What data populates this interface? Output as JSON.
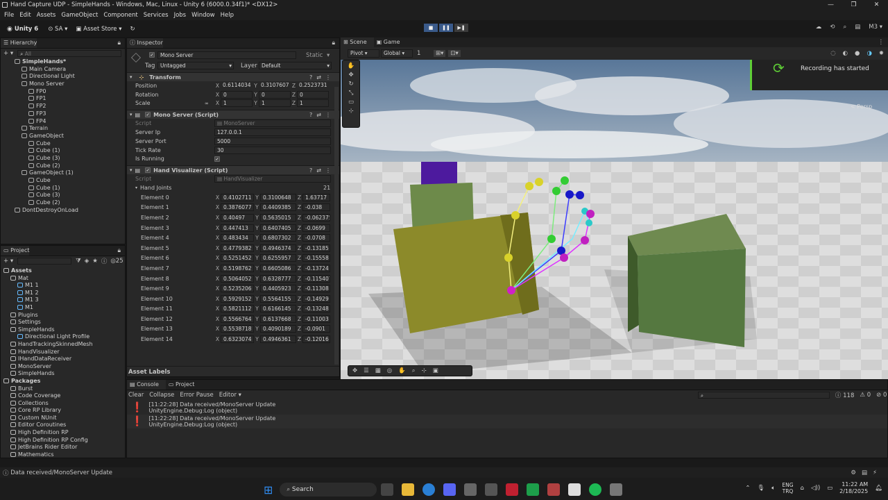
{
  "window": {
    "title": "Hand Capture UDP - SimpleHands - Windows, Mac, Linux - Unity 6 (6000.0.34f1)* <DX12>",
    "controls": [
      "—",
      "❐",
      "✕"
    ]
  },
  "menu": [
    "File",
    "Edit",
    "Assets",
    "GameObject",
    "Component",
    "Services",
    "Jobs",
    "Window",
    "Help"
  ],
  "toolbar": {
    "account": "Unity 6",
    "user": "SA",
    "store": "Asset Store",
    "layout": "M3"
  },
  "hierarchy": {
    "tab": "Hierarchy",
    "search_placeholder": "All",
    "items": [
      {
        "label": "SimpleHands*",
        "indent": 0,
        "bold": true
      },
      {
        "label": "Main Camera",
        "indent": 1
      },
      {
        "label": "Directional Light",
        "indent": 1
      },
      {
        "label": "Mono Server",
        "indent": 1
      },
      {
        "label": "FP0",
        "indent": 2
      },
      {
        "label": "FP1",
        "indent": 2
      },
      {
        "label": "FP2",
        "indent": 2
      },
      {
        "label": "FP3",
        "indent": 2
      },
      {
        "label": "FP4",
        "indent": 2
      },
      {
        "label": "Terrain",
        "indent": 1
      },
      {
        "label": "GameObject",
        "indent": 1
      },
      {
        "label": "Cube",
        "indent": 2
      },
      {
        "label": "Cube (1)",
        "indent": 2
      },
      {
        "label": "Cube (3)",
        "indent": 2
      },
      {
        "label": "Cube (2)",
        "indent": 2
      },
      {
        "label": "GameObject (1)",
        "indent": 1
      },
      {
        "label": "Cube",
        "indent": 2
      },
      {
        "label": "Cube (1)",
        "indent": 2
      },
      {
        "label": "Cube (3)",
        "indent": 2
      },
      {
        "label": "Cube (2)",
        "indent": 2
      },
      {
        "label": "DontDestroyOnLoad",
        "indent": 0
      }
    ]
  },
  "project": {
    "tab": "Project",
    "badge": "25",
    "items": [
      {
        "label": "Assets",
        "indent": 0,
        "bold": true
      },
      {
        "label": "Mat",
        "indent": 1
      },
      {
        "label": "M1 1",
        "indent": 2
      },
      {
        "label": "M1 2",
        "indent": 2
      },
      {
        "label": "M1 3",
        "indent": 2
      },
      {
        "label": "M1",
        "indent": 2
      },
      {
        "label": "Plugins",
        "indent": 1
      },
      {
        "label": "Settings",
        "indent": 1
      },
      {
        "label": "SimpleHands",
        "indent": 1
      },
      {
        "label": "Directional Light Profile",
        "indent": 2
      },
      {
        "label": "HandTrackingSkinnedMesh",
        "indent": 1
      },
      {
        "label": "HandVisualizer",
        "indent": 1
      },
      {
        "label": "IHandDataReceiver",
        "indent": 1
      },
      {
        "label": "MonoServer",
        "indent": 1
      },
      {
        "label": "SimpleHands",
        "indent": 1
      },
      {
        "label": "Packages",
        "indent": 0,
        "bold": true
      },
      {
        "label": "Burst",
        "indent": 1
      },
      {
        "label": "Code Coverage",
        "indent": 1
      },
      {
        "label": "Collections",
        "indent": 1
      },
      {
        "label": "Core RP Library",
        "indent": 1
      },
      {
        "label": "Custom NUnit",
        "indent": 1
      },
      {
        "label": "Editor Coroutines",
        "indent": 1
      },
      {
        "label": "High Definition RP",
        "indent": 1
      },
      {
        "label": "High Definition RP Config",
        "indent": 1
      },
      {
        "label": "JetBrains Rider Editor",
        "indent": 1
      },
      {
        "label": "Mathematics",
        "indent": 1
      }
    ]
  },
  "inspector": {
    "tab": "Inspector",
    "object_name": "Mono Server",
    "static_label": "Static",
    "tag_label": "Tag",
    "tag_value": "Untagged",
    "layer_label": "Layer",
    "layer_value": "Default",
    "transform": {
      "title": "Transform",
      "position_label": "Position",
      "rotation_label": "Rotation",
      "scale_label": "Scale",
      "position": [
        "0.6114034",
        "0.3107607",
        "0.2523731"
      ],
      "rotation": [
        "0",
        "0",
        "0"
      ],
      "scale": [
        "1",
        "1",
        "1"
      ]
    },
    "mono": {
      "title": "Mono Server (Script)",
      "script_label": "Script",
      "script_value": "MonoServer",
      "fields": [
        {
          "label": "Server Ip",
          "value": "127.0.0.1"
        },
        {
          "label": "Server Port",
          "value": "5000"
        },
        {
          "label": "Tick Rate",
          "value": "30"
        },
        {
          "label": "Is Running",
          "value": "✓"
        }
      ]
    },
    "hv": {
      "title": "Hand Visualizer (Script)",
      "script_label": "Script",
      "script_value": "HandVisualizer",
      "joints_label": "Hand Joints",
      "joints_count": "21",
      "elements": [
        {
          "label": "Element 0",
          "x": "0.4102711",
          "y": "0.3100648",
          "z": "1.63717"
        },
        {
          "label": "Element 1",
          "x": "0.3876077",
          "y": "0.4409385",
          "z": "-0.038"
        },
        {
          "label": "Element 2",
          "x": "0.40497",
          "y": "0.5635015",
          "z": "-0.062375"
        },
        {
          "label": "Element 3",
          "x": "0.447413",
          "y": "0.6407405",
          "z": "-0.0699"
        },
        {
          "label": "Element 4",
          "x": "0.483434",
          "y": "0.6807302",
          "z": "-0.0708"
        },
        {
          "label": "Element 5",
          "x": "0.4779382",
          "y": "0.4946374",
          "z": "-0.13185"
        },
        {
          "label": "Element 6",
          "x": "0.5251452",
          "y": "0.6255957",
          "z": "-0.15558"
        },
        {
          "label": "Element 7",
          "x": "0.5198762",
          "y": "0.6605086",
          "z": "-0.13724"
        },
        {
          "label": "Element 8",
          "x": "0.5064052",
          "y": "0.6328777",
          "z": "-0.115407"
        },
        {
          "label": "Element 9",
          "x": "0.5235206",
          "y": "0.4405923",
          "z": "-0.11308"
        },
        {
          "label": "Element 10",
          "x": "0.5929152",
          "y": "0.5564155",
          "z": "-0.14929"
        },
        {
          "label": "Element 11",
          "x": "0.5821112",
          "y": "0.6166145",
          "z": "-0.13248"
        },
        {
          "label": "Element 12",
          "x": "0.5566764",
          "y": "0.6137668",
          "z": "-0.11003"
        },
        {
          "label": "Element 13",
          "x": "0.5538718",
          "y": "0.4090189",
          "z": "-0.0901"
        },
        {
          "label": "Element 14",
          "x": "0.6323074",
          "y": "0.4946361",
          "z": "-0.12016"
        }
      ]
    },
    "asset_labels": "Asset Labels"
  },
  "scene": {
    "tab_scene": "Scene",
    "tab_game": "Game",
    "pivot": "Pivot",
    "global": "Global",
    "grid": "1",
    "persp": "< Persp",
    "notification": "Recording has started"
  },
  "console": {
    "tab_console": "Console",
    "tab_project": "Project",
    "clear": "Clear",
    "collapse": "Collapse",
    "error_pause": "Error Pause",
    "editor": "Editor",
    "count_log": "118",
    "count_warn": "0",
    "count_err": "0",
    "lines": [
      {
        "main": "[11:22:28] Data received/MonoServer Update",
        "sub": "UnityEngine.Debug:Log (object)"
      },
      {
        "main": "[11:22:28] Data received/MonoServer Update",
        "sub": "UnityEngine.Debug:Log (object)"
      }
    ]
  },
  "status": "Data received/MonoServer Update",
  "taskbar": {
    "search": "Search",
    "lang1": "ENG",
    "lang2": "TRQ",
    "time": "11:22 AM",
    "date": "2/18/2025"
  }
}
